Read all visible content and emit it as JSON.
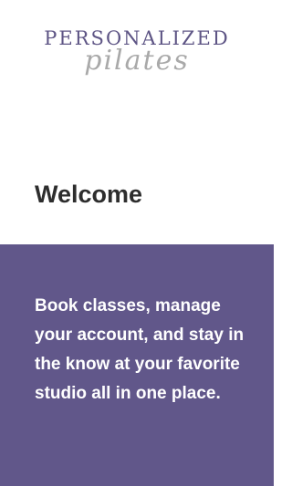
{
  "brand": {
    "logo_primary": "PERSONALIZED",
    "logo_script": "pilates"
  },
  "welcome": {
    "title": "Welcome"
  },
  "promo": {
    "tagline": "Book classes, manage your account, and stay in the know at your favorite studio all in one place."
  },
  "colors": {
    "brand_purple": "#61578a",
    "logo_purple": "#5e5585",
    "logo_gray": "#a9a9a9",
    "title_text": "#2d2d2d",
    "tagline_text": "#ffffff"
  }
}
